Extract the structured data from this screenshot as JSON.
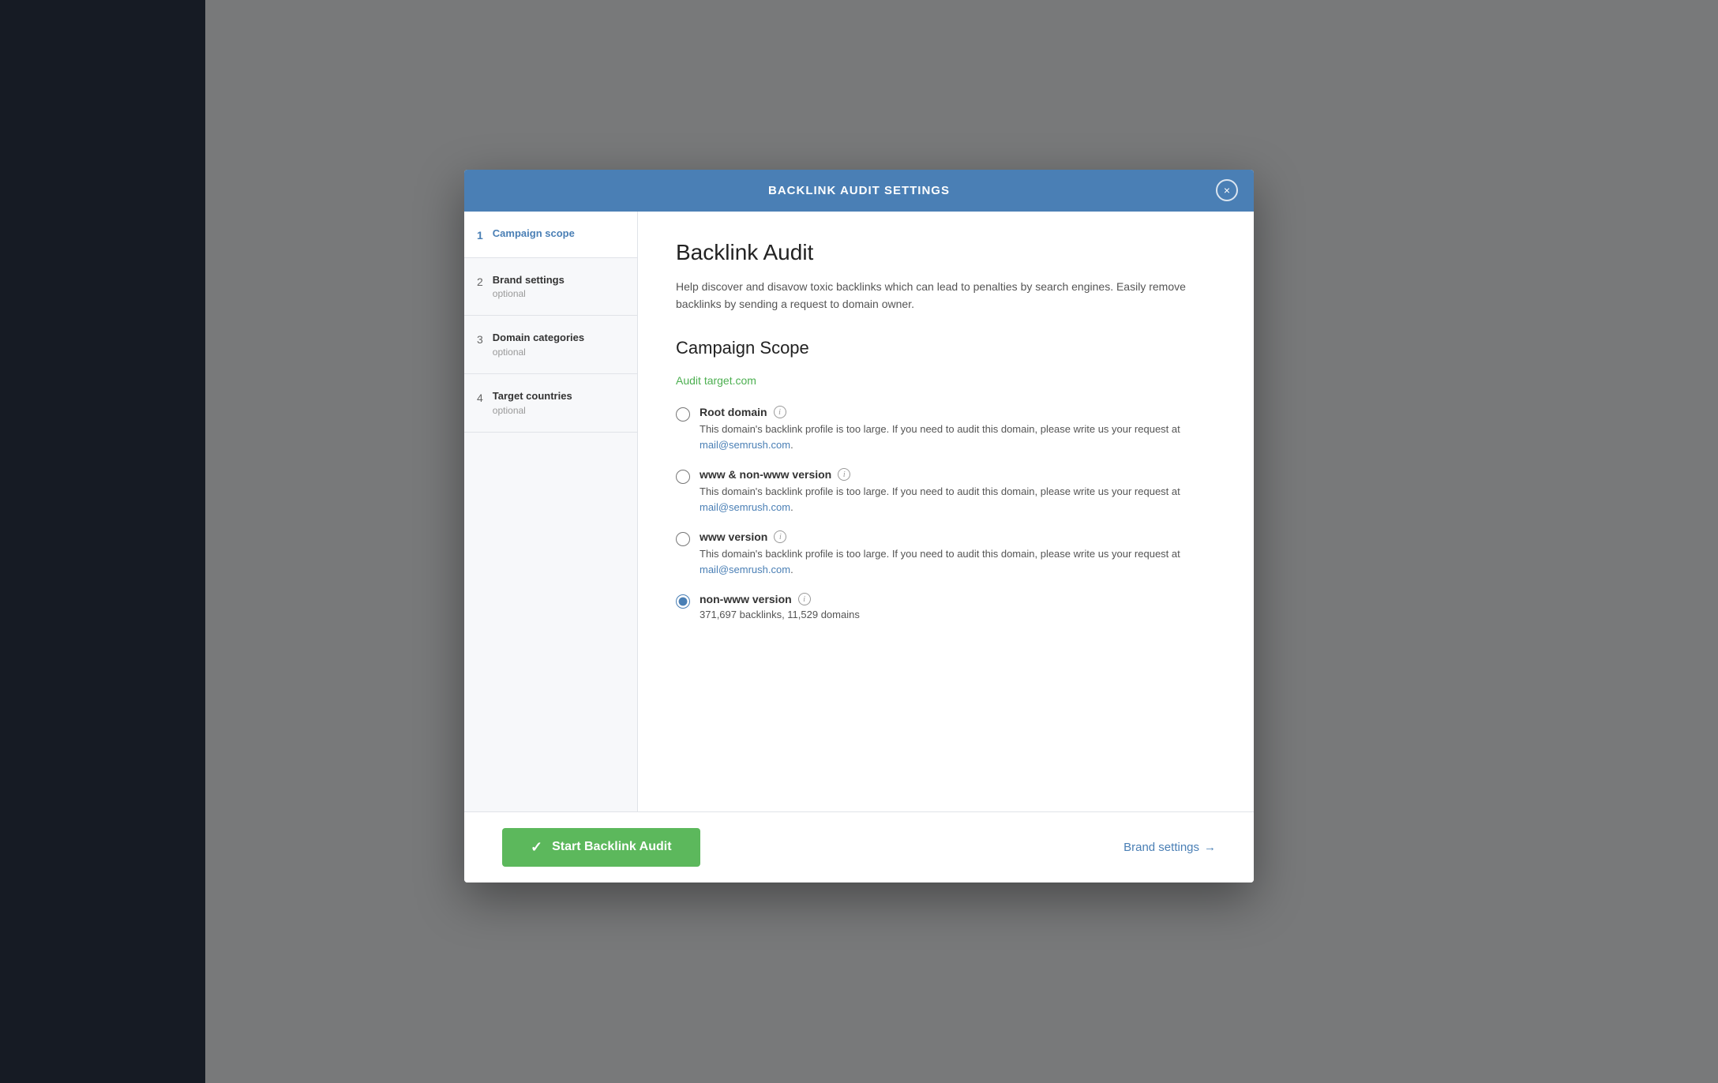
{
  "modal": {
    "header": {
      "title": "BACKLINK AUDIT SETTINGS",
      "close_label": "×"
    },
    "page_title": "Backlink Audit",
    "page_description": "Help discover and disavow toxic backlinks which can lead to penalties by search engines. Easily remove backlinks by sending a request to domain owner.",
    "section_title": "Campaign Scope",
    "audit_label": "Audit",
    "audit_target": "target.com",
    "steps": [
      {
        "number": "1",
        "title": "Campaign scope",
        "subtitle": "",
        "active": true
      },
      {
        "number": "2",
        "title": "Brand settings",
        "subtitle": "optional",
        "active": false
      },
      {
        "number": "3",
        "title": "Domain categories",
        "subtitle": "optional",
        "active": false
      },
      {
        "number": "4",
        "title": "Target countries",
        "subtitle": "optional",
        "active": false
      }
    ],
    "radio_options": [
      {
        "id": "root_domain",
        "label": "Root domain",
        "checked": false,
        "description": "This domain's backlink profile is too large. If you need to audit this domain, please write us your request at",
        "email": "mail@semrush.com",
        "has_email": true
      },
      {
        "id": "www_non_www",
        "label": "www & non-www version",
        "checked": false,
        "description": "This domain's backlink profile is too large. If you need to audit this domain, please write us your request at",
        "email": "mail@semrush.com",
        "has_email": true
      },
      {
        "id": "www_version",
        "label": "www version",
        "checked": false,
        "description": "This domain's backlink profile is too large. If you need to audit this domain, please write us your request at",
        "email": "mail@semrush.com",
        "has_email": true
      },
      {
        "id": "non_www_version",
        "label": "non-www version",
        "checked": true,
        "stats": "371,697 backlinks, 11,529 domains",
        "has_email": false
      }
    ],
    "footer": {
      "start_button_label": "Start Backlink Audit",
      "brand_settings_label": "Brand settings",
      "arrow": "→"
    }
  }
}
